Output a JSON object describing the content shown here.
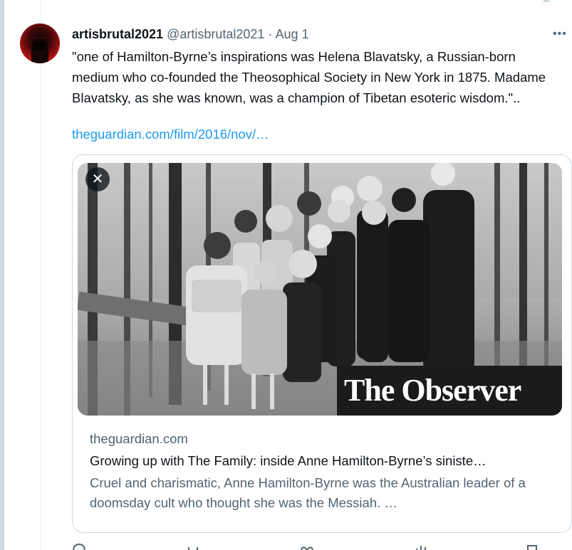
{
  "tweet": {
    "display_name": "artisbrutal2021",
    "handle": "@artisbrutal2021",
    "separator": "·",
    "date": "Aug 1",
    "more_label": "•••",
    "text": "\"one of Hamilton-Byrne’s inspirations was Helena Blavatsky, a Russian-born medium who co-founded the Theosophical Society in New York in 1875. Madame Blavatsky, as she was known, was a champion of Tibetan esoteric wisdom.\"..",
    "link_text": "theguardian.com/film/2016/nov/…"
  },
  "card": {
    "close_label": "✕",
    "image_overlay_text": "The Observer",
    "domain": "theguardian.com",
    "title": "Growing up with The Family: inside Anne Hamilton-Byrne’s siniste…",
    "description": "Cruel and charismatic, Anne Hamilton-Byrne was the Australian leader of a doomsday cult who thought she was the Messiah. …"
  },
  "icons": {
    "avatar": "avatar-image",
    "close": "close-icon",
    "more": "more-icon",
    "reply": "reply-icon",
    "retweet": "retweet-icon",
    "like": "like-icon",
    "views": "views-icon",
    "bookmark": "bookmark-icon"
  },
  "colors": {
    "link": "#1d9bf0",
    "secondary_text": "#536471",
    "primary_text": "#0f1419",
    "border": "#cfd9de"
  }
}
